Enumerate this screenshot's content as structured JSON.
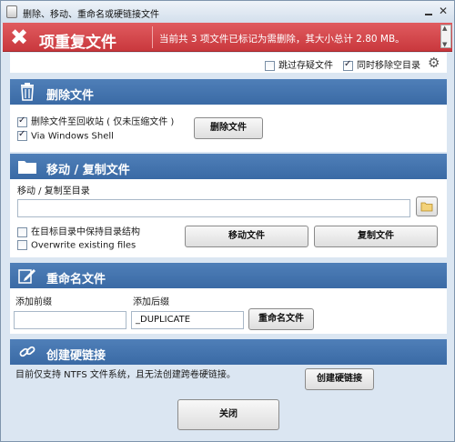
{
  "window": {
    "title": "删除、移动、重命名或硬链接文件"
  },
  "banner": {
    "title": "项重复文件",
    "message": "当前共 3 项文件已标记为需删除，其大小总计 2.80 MB。"
  },
  "options": {
    "skip_suspect": {
      "label": "跳过存疑文件",
      "checked": false
    },
    "remove_empty": {
      "label": "同时移除空目录",
      "checked": true
    }
  },
  "delete": {
    "title": "删除文件",
    "recycle": {
      "label": "删除文件至回收站 ( 仅未压缩文件 )",
      "checked": true
    },
    "shell": {
      "label": "Via Windows Shell",
      "checked": true
    },
    "button": "删除文件"
  },
  "move": {
    "title": "移动 / 复制文件",
    "target_label": "移动 / 复制至目录",
    "target_value": "",
    "keep_structure": {
      "label": "在目标目录中保持目录结构",
      "checked": false
    },
    "overwrite": {
      "label": "Overwrite existing files",
      "checked": false
    },
    "move_button": "移动文件",
    "copy_button": "复制文件"
  },
  "rename": {
    "title": "重命名文件",
    "prefix_label": "添加前缀",
    "prefix_value": "",
    "suffix_label": "添加后缀",
    "suffix_value": "_DUPLICATE",
    "button": "重命名文件"
  },
  "hardlink": {
    "title": "创建硬链接",
    "note": "目前仅支持 NTFS 文件系统，且无法创建跨卷硬链接。",
    "button": "创建硬链接"
  },
  "footer": {
    "close_button": "关闭"
  },
  "colors": {
    "banner_red": "#d2454a",
    "section_blue": "#4574ae",
    "window_bg": "#dbe6f2"
  },
  "icons": {
    "banner": "close-x-icon",
    "delete": "trash-icon",
    "move": "folder-icon",
    "rename": "pencil-icon",
    "hardlink": "link-icon",
    "settings": "gear-icon",
    "browse": "folder-icon"
  }
}
